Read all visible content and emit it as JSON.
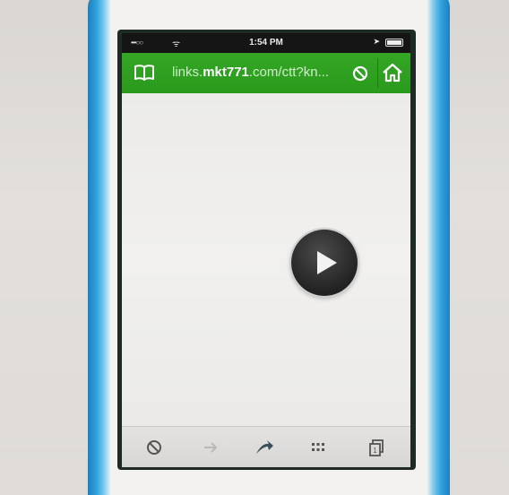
{
  "status_bar": {
    "signal": "•••○○",
    "wifi": "ᯤ",
    "time": "1:54 PM",
    "location_icon": "location-arrow-icon",
    "battery_level": 1.0
  },
  "url_bar": {
    "url_prefix": "links.",
    "url_domain": "mkt771",
    "url_rest": ".com/ctt?kn...",
    "left_icon": "bookmarks-book-icon",
    "stop_icon": "block-icon",
    "home_icon": "home-icon",
    "accent_color": "#2fa21f"
  },
  "content": {
    "play_icon": "play-icon"
  },
  "toolbar": {
    "icons": [
      "block-icon",
      "forward-arrow-icon",
      "share-swoosh-icon",
      "grid-dots-icon",
      "tabs-copy-icon"
    ]
  }
}
